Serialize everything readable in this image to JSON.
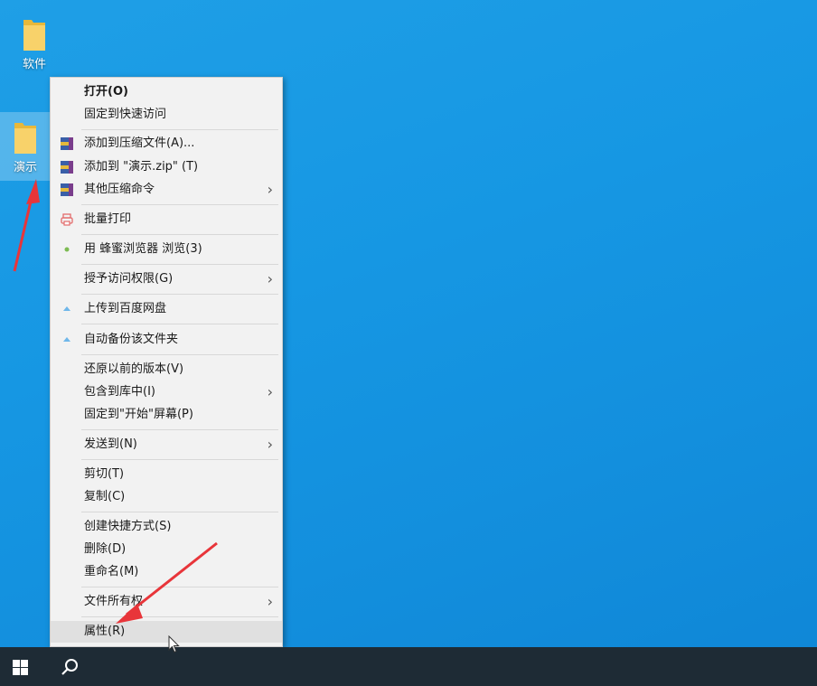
{
  "desktop": {
    "icons": [
      {
        "label": "软件"
      },
      {
        "label": "演示"
      }
    ]
  },
  "context_menu": {
    "items": [
      {
        "label": "打开(O)"
      },
      {
        "label": "固定到快速访问"
      },
      {
        "label": "添加到压缩文件(A)..."
      },
      {
        "label": "添加到 \"演示.zip\" (T)"
      },
      {
        "label": "其他压缩命令"
      },
      {
        "label": "批量打印"
      },
      {
        "label": "用 蜂蜜浏览器 浏览(3)"
      },
      {
        "label": "授予访问权限(G)"
      },
      {
        "label": "上传到百度网盘"
      },
      {
        "label": "自动备份该文件夹"
      },
      {
        "label": "还原以前的版本(V)"
      },
      {
        "label": "包含到库中(I)"
      },
      {
        "label": "固定到\"开始\"屏幕(P)"
      },
      {
        "label": "发送到(N)"
      },
      {
        "label": "剪切(T)"
      },
      {
        "label": "复制(C)"
      },
      {
        "label": "创建快捷方式(S)"
      },
      {
        "label": "删除(D)"
      },
      {
        "label": "重命名(M)"
      },
      {
        "label": "文件所有权"
      },
      {
        "label": "属性(R)"
      }
    ]
  },
  "colors": {
    "desktop": "#1697e3",
    "taskbar": "#1e2b35",
    "annotation": "#e8353a"
  }
}
